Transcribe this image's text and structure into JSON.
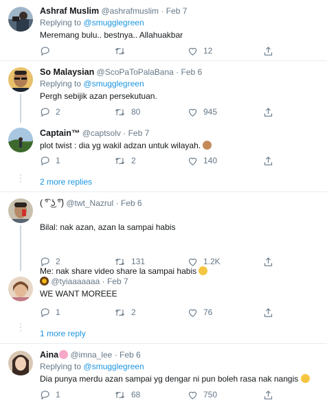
{
  "colors": {
    "link": "#1b95e0",
    "muted": "#657786",
    "text": "#14171a",
    "border": "#e6ecf0"
  },
  "tweets": [
    {
      "name": "Ashraf Muslim",
      "handle": "@ashrafmuslim",
      "sep": "·",
      "date": "Feb 7",
      "replying_prefix": "Replying to",
      "replying_to": "@smugglegreen",
      "text": "Meremang bulu.. bestnya.. Allahuakbar",
      "replies": "",
      "retweets": "",
      "likes": "12"
    },
    {
      "name": "So Malaysian",
      "handle": "@ScoPaToPalaBana",
      "sep": "·",
      "date": "Feb 6",
      "replying_prefix": "Replying to",
      "replying_to": "@smugglegreen",
      "text": "Pergh sebijik azan persekutuan.",
      "replies": "2",
      "retweets": "80",
      "likes": "945"
    },
    {
      "name": "Captain™",
      "handle": "@captsolv",
      "sep": "·",
      "date": "Feb 7",
      "text": "plot twist : dia yg wakil adzan untuk wilayah.",
      "emoji": "see-no-evil-monkey",
      "replies": "1",
      "retweets": "2",
      "likes": "140"
    },
    {
      "name": "( ͡° ͜ʖ ͡°)",
      "handle": "@twt_Nazrul",
      "sep": "·",
      "date": "Feb 6",
      "text_line1": "Bilal: nak azan, azan la sampai habis",
      "text_line2": "Me: nak share video share la sampai habis",
      "emoji": "loudly-crying-face",
      "replies": "2",
      "retweets": "131",
      "likes": "1.2K"
    },
    {
      "name_emoji": "sunflower",
      "handle": "@tyiaaaaaaa",
      "sep": "·",
      "date": "Feb 7",
      "text": "WE WANT MOREEE",
      "replies": "1",
      "retweets": "2",
      "likes": "76"
    },
    {
      "name": "Aina",
      "name_emoji": "cherry-blossom",
      "handle": "@imna_lee",
      "sep": "·",
      "date": "Feb 6",
      "replying_prefix": "Replying to",
      "replying_to": "@smugglegreen",
      "text": "Dia punya merdu azan sampai yg dengar ni pun boleh rasa nak nangis",
      "emoji": "loudly-crying-face",
      "replies": "1",
      "retweets": "68",
      "likes": "750"
    }
  ],
  "more_replies_1": "2 more replies",
  "more_replies_2": "1 more reply"
}
